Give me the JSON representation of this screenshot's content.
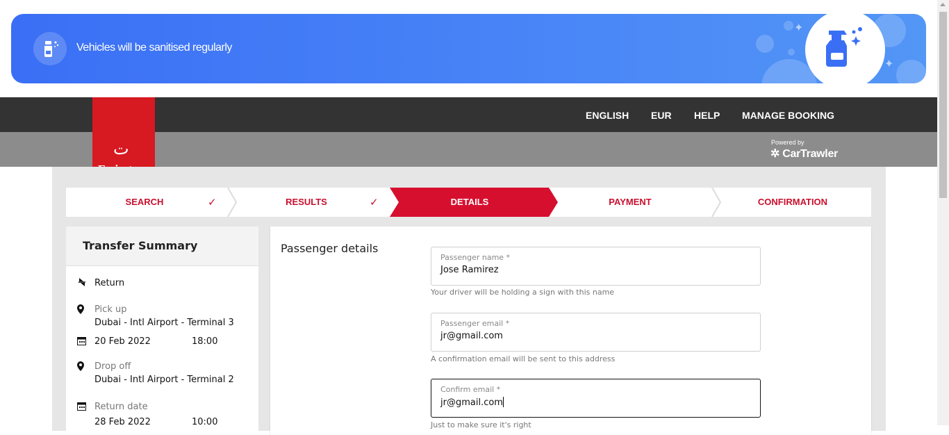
{
  "banner": {
    "text": "Vehicles will be sanitised regularly",
    "icon": "spray-bottle-icon"
  },
  "topnav": {
    "language": "ENGLISH",
    "currency": "EUR",
    "help": "HELP",
    "manage_booking": "MANAGE BOOKING"
  },
  "brand": {
    "logo_text": "Emirates",
    "powered_by": "Powered by",
    "partner": "CarTrawler"
  },
  "steps": [
    {
      "label": "SEARCH",
      "state": "done"
    },
    {
      "label": "RESULTS",
      "state": "done"
    },
    {
      "label": "DETAILS",
      "state": "active"
    },
    {
      "label": "PAYMENT",
      "state": "pending"
    },
    {
      "label": "CONFIRMATION",
      "state": "pending"
    }
  ],
  "summary": {
    "title": "Transfer Summary",
    "trip_type": "Return",
    "pickup_label": "Pick up",
    "pickup_location": "Dubai - Intl Airport - Terminal 3",
    "pickup_date": "20 Feb 2022",
    "pickup_time": "18:00",
    "dropoff_label": "Drop off",
    "dropoff_location": "Dubai - Intl Airport - Terminal 2",
    "return_label": "Return date",
    "return_date": "28 Feb 2022",
    "return_time": "10:00"
  },
  "details": {
    "title": "Passenger details",
    "name_label": "Passenger name *",
    "name_value": "Jose Ramirez",
    "name_hint": "Your driver will be holding a sign with this name",
    "email_label": "Passenger email *",
    "email_value": "jr@gmail.com",
    "email_hint": "A confirmation email will be sent to this address",
    "confirm_label": "Confirm email *",
    "confirm_value": "jr@gmail.com",
    "confirm_hint": "Just to make sure it's right"
  },
  "colors": {
    "brand_red": "#d70f2f",
    "banner_blue": "#3a6ff5",
    "nav_dark": "#333333",
    "nav_grey": "#8c8c8c"
  }
}
